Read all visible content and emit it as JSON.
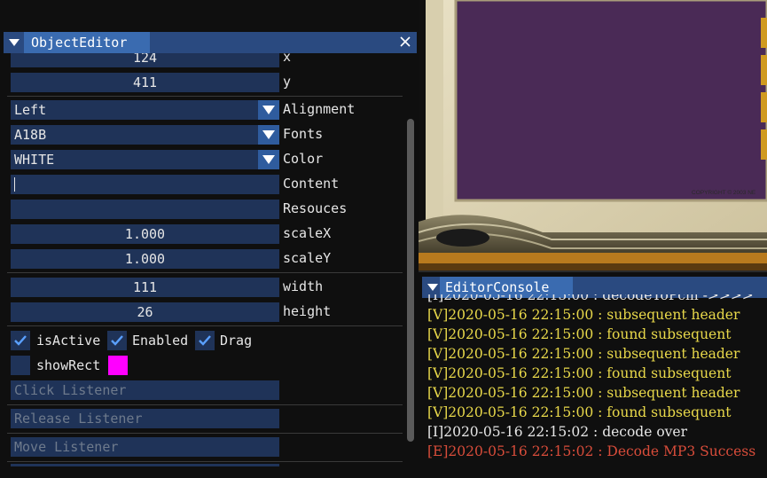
{
  "object_editor": {
    "title": "ObjectEditor",
    "fields": [
      {
        "value": "124",
        "label": "x",
        "kind": "number"
      },
      {
        "value": "411",
        "label": "y",
        "kind": "number"
      },
      {
        "value": "Left",
        "label": "Alignment",
        "kind": "combo"
      },
      {
        "value": "A18B",
        "label": "Fonts",
        "kind": "combo"
      },
      {
        "value": "WHITE",
        "label": "Color",
        "kind": "combo"
      },
      {
        "value": "",
        "label": "Content",
        "kind": "text"
      },
      {
        "value": "",
        "label": "Resouces",
        "kind": "text"
      },
      {
        "value": "1.000",
        "label": "scaleX",
        "kind": "number"
      },
      {
        "value": "1.000",
        "label": "scaleY",
        "kind": "number"
      },
      {
        "value": "111",
        "label": "width",
        "kind": "number"
      },
      {
        "value": "26",
        "label": "height",
        "kind": "number"
      }
    ],
    "checkboxes": [
      {
        "label": "isActive",
        "checked": true
      },
      {
        "label": "Enabled",
        "checked": true
      },
      {
        "label": "Drag",
        "checked": true
      },
      {
        "label": "showRect",
        "checked": false
      }
    ],
    "rect_color": "#ff00ff",
    "listeners": [
      "Click Listener",
      "Release Listener",
      "Move Listener"
    ]
  },
  "editor_console": {
    "title": "EditorConsole",
    "lines": [
      {
        "level": "I",
        "text": "[I]2020-05-16 22:15:00  : decodeToPcm ->>>>"
      },
      {
        "level": "V",
        "text": "[V]2020-05-16 22:15:00  : subsequent header"
      },
      {
        "level": "V",
        "text": "[V]2020-05-16 22:15:00  : found subsequent"
      },
      {
        "level": "V",
        "text": "[V]2020-05-16 22:15:00  : subsequent header"
      },
      {
        "level": "V",
        "text": "[V]2020-05-16 22:15:00  : found subsequent"
      },
      {
        "level": "V",
        "text": "[V]2020-05-16 22:15:00  : subsequent header"
      },
      {
        "level": "V",
        "text": "[V]2020-05-16 22:15:00  : found subsequent"
      },
      {
        "level": "I",
        "text": "[I]2020-05-16 22:15:02  : decode over"
      },
      {
        "level": "E",
        "text": "[E]2020-05-16 22:15:02  : Decode MP3 Success"
      }
    ]
  },
  "game_view": {
    "copyright": "COPYRIGHT © 2003 NE"
  },
  "colors": {
    "accent": "#2a4a80",
    "tab": "#3a6bb0",
    "field": "#1f3358",
    "check": "#5aa0ff",
    "verbose": "#e8d84a",
    "error": "#d84c3a"
  },
  "icons": {
    "collapse": "triangle-down-icon",
    "close": "close-icon",
    "dropdown": "triangle-down-icon",
    "check": "checkmark-icon"
  }
}
